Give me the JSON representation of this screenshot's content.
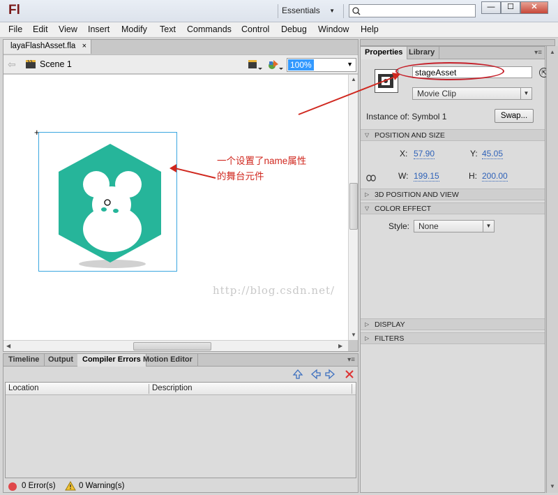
{
  "app": {
    "logo": "Fl",
    "workspace": "Essentials"
  },
  "window_controls": {
    "minimize": "—",
    "restore": "☐",
    "close": "✕"
  },
  "menu": [
    "File",
    "Edit",
    "View",
    "Insert",
    "Modify",
    "Text",
    "Commands",
    "Control",
    "Debug",
    "Window",
    "Help"
  ],
  "document": {
    "tab_label": "layaFlashAsset.fla",
    "tab_close": "×",
    "scene": "Scene 1",
    "zoom": "100%"
  },
  "stage": {
    "annotation": [
      "一个设置了name属性",
      "的舞台元件"
    ],
    "watermark": "http://blog.csdn.net/",
    "logo_color": "#26b59a",
    "annotation_color": "#d0281f"
  },
  "bottom_panel": {
    "tabs": [
      "Timeline",
      "Output",
      "Compiler Errors",
      "Motion Editor"
    ],
    "active_tab": "Compiler Errors",
    "columns": [
      "Location",
      "Description"
    ],
    "errors": "0 Error(s)",
    "warnings": "0 Warning(s)"
  },
  "properties": {
    "tabs": [
      "Properties",
      "Library"
    ],
    "instance_name": "stageAsset",
    "symbol_type": "Movie Clip",
    "instance_of_label": "Instance of:",
    "instance_of_value": "Symbol 1",
    "swap_label": "Swap...",
    "sections": {
      "position_size": "POSITION AND SIZE",
      "position_3d": "3D POSITION AND VIEW",
      "color_effect": "COLOR EFFECT",
      "display": "DISPLAY",
      "filters": "FILTERS"
    },
    "x_label": "X:",
    "x_value": "57.90",
    "y_label": "Y:",
    "y_value": "45.05",
    "w_label": "W:",
    "w_value": "199.15",
    "h_label": "H:",
    "h_value": "200.00",
    "style_label": "Style:",
    "style_value": "None"
  }
}
